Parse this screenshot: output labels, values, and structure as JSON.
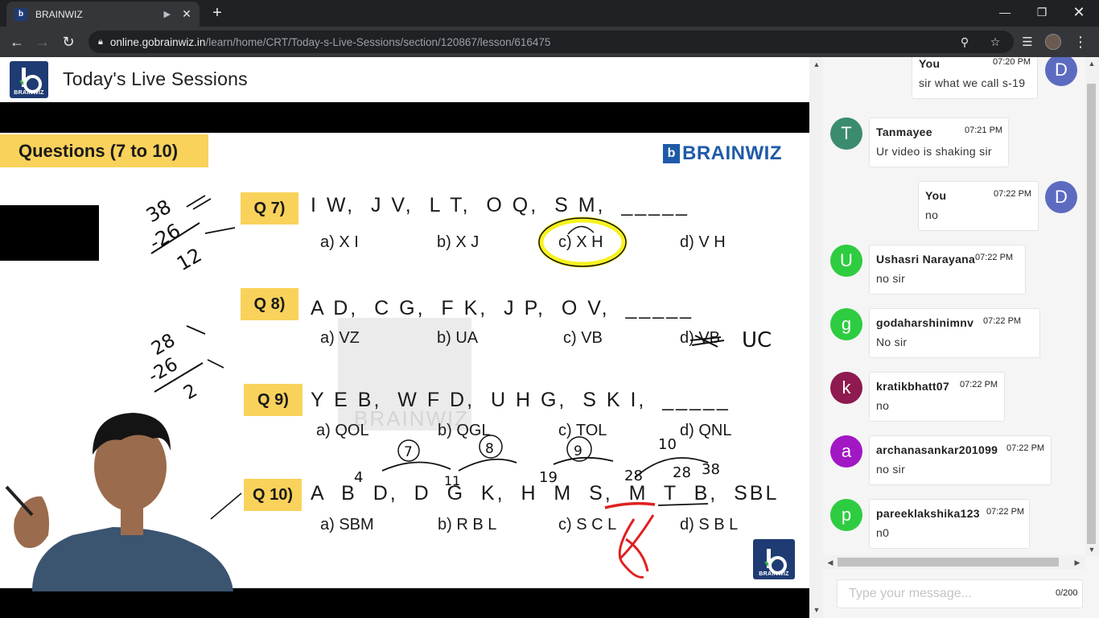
{
  "browser": {
    "tab_title": "BRAINWIZ",
    "tab_audio_icon": "speaker-icon",
    "url_host": "online.gobrainwiz.in",
    "url_path": "/learn/home/CRT/Today-s-Live-Sessions/section/120867/lesson/616475"
  },
  "header": {
    "logo_text": "BRAINWIZ",
    "title": "Today's Live Sessions"
  },
  "slide": {
    "heading": "Questions (7 to 10)",
    "brand": "BRAINWIZ",
    "watermark": "BRAINWIZ",
    "bottom_logo_text": "BRAINWIZ",
    "questions": [
      {
        "label": "Q 7)",
        "text": "I W,  J V,  L T,  O Q,  S M,  _____",
        "options": [
          "a) X I",
          "b) X J",
          "c) X H",
          "d) V H"
        ]
      },
      {
        "label": "Q 8)",
        "text": "A D,  C G,  F K,  J P,  O V,  _____",
        "options": [
          "a) VZ",
          "b) UA",
          "c) VB",
          "d) VB"
        ]
      },
      {
        "label": "Q 9)",
        "text": "Y E B,  W F D,  U H G,  S K I,  _____",
        "options": [
          "a) QOL",
          "b) QGL",
          "c) TOL",
          "d) QNL"
        ]
      },
      {
        "label": "Q 10)",
        "text": "A  B  D,  D  G  K,  H  M  S,  M  T  B,  SBL",
        "options": [
          "a) SBM",
          "b) R B L",
          "c) S C L",
          "d) S B L"
        ]
      }
    ],
    "handwriting": {
      "q7_note": [
        "38",
        "-26",
        "12"
      ],
      "q8_note": [
        "28",
        "-26",
        "2"
      ],
      "q8_answer": "UC",
      "q10_gaps": [
        "4",
        "7",
        "8",
        "11",
        "9",
        "19",
        "10",
        "28",
        "28",
        "38"
      ]
    }
  },
  "chat": {
    "messages": [
      {
        "sender": "You",
        "time": "07:20 PM",
        "text": "sir what we call  s-19",
        "initial": "D",
        "color": "#5c6bc0",
        "mine": true
      },
      {
        "sender": "Tanmayee",
        "time": "07:21 PM",
        "text": "Ur video is shaking sir",
        "initial": "T",
        "color": "#3b8c6e",
        "mine": false
      },
      {
        "sender": "You",
        "time": "07:22 PM",
        "text": "no",
        "initial": "D",
        "color": "#5c6bc0",
        "mine": true
      },
      {
        "sender": "Ushasri Narayana",
        "time": "07:22 PM",
        "text": "no sir",
        "initial": "U",
        "color": "#2ecc40",
        "mine": false
      },
      {
        "sender": "godaharshinimnv",
        "time": "07:22 PM",
        "text": "No sir",
        "initial": "g",
        "color": "#2ecc40",
        "mine": false
      },
      {
        "sender": "kratikbhatt07",
        "time": "07:22 PM",
        "text": "no",
        "initial": "k",
        "color": "#8e1a4f",
        "mine": false
      },
      {
        "sender": "archanasankar201099",
        "time": "07:22 PM",
        "text": "no sir",
        "initial": "a",
        "color": "#a117c4",
        "mine": false
      },
      {
        "sender": "pareeklakshika123",
        "time": "07:22 PM",
        "text": "n0",
        "initial": "p",
        "color": "#2ecc40",
        "mine": false
      }
    ],
    "input_placeholder": "Type your message...",
    "char_count": "0/200"
  }
}
